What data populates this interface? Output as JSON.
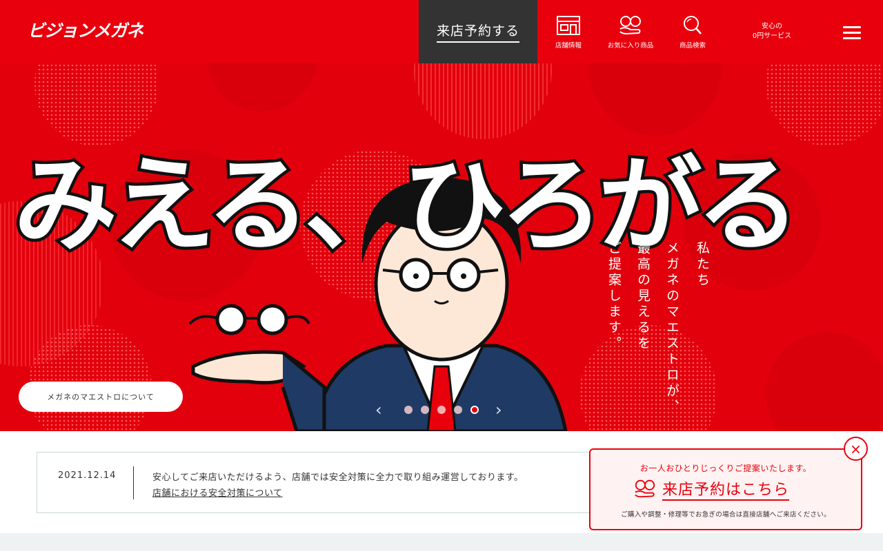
{
  "header": {
    "logo": "ビジョンメガネ",
    "reserve_label": "来店予約する",
    "nav": [
      {
        "label": "店舗情報",
        "icon": "store-icon"
      },
      {
        "label": "お気に入り商品",
        "icon": "heart-hand-icon"
      },
      {
        "label": "商品検索",
        "icon": "search-icon"
      }
    ],
    "zero_service_line1": "安心の",
    "zero_service_line2": "0円サービス"
  },
  "hero": {
    "headline": "みえる、ひろがる",
    "vertical_lines": [
      "私たち",
      "メガネのマエストロが、",
      "最高の見えるを",
      "ご提案します。"
    ],
    "about_button": "メガネのマエストロについて",
    "slides_total": 5,
    "active_slide": 5
  },
  "notice": {
    "date": "2021.12.14",
    "message": "安心してご来店いただけるよう、店舗では安全対策に全力で取り組み運営しております。",
    "link": "店舗における安全対策について"
  },
  "popup": {
    "top_text": "お一人おひとりじっくりご提案いたします。",
    "main_text": "来店予約はこちら",
    "footer_text": "ご購入や調整・修理等でお急ぎの場合は直接店舗へご来店ください。",
    "close_label": "×"
  },
  "colors": {
    "brand_red": "#e8000d",
    "dark_button": "#333333",
    "hero_bg": "#e2000c"
  }
}
